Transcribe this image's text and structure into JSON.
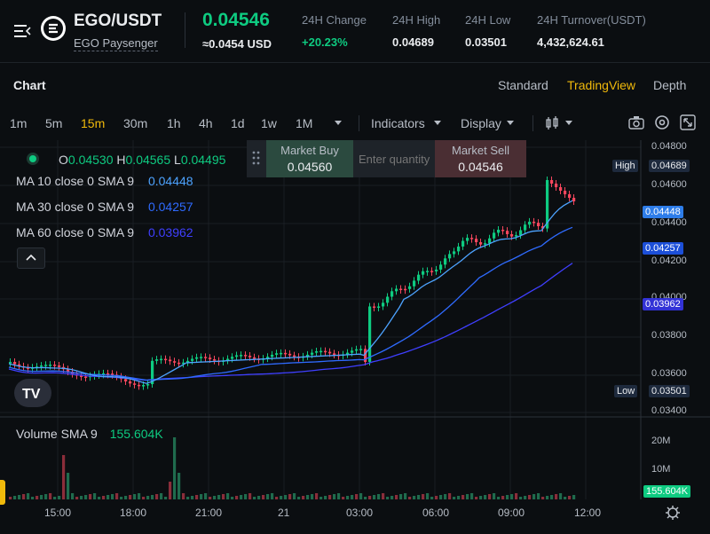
{
  "header": {
    "pair": "EGO/USDT",
    "pair_name": "EGO Paysenger",
    "last_price": "0.04546",
    "last_price_usd": "≈0.0454 USD",
    "stats": [
      {
        "label": "24H Change",
        "value": "+20.23%",
        "color": "#0ecb81"
      },
      {
        "label": "24H High",
        "value": "0.04689",
        "color": "#eaecef"
      },
      {
        "label": "24H Low",
        "value": "0.03501",
        "color": "#eaecef"
      },
      {
        "label": "24H Turnover(USDT)",
        "value": "4,432,624.61",
        "color": "#eaecef"
      }
    ]
  },
  "chart_header": {
    "title": "Chart",
    "views": [
      {
        "label": "Standard",
        "active": false
      },
      {
        "label": "TradingView",
        "active": true
      },
      {
        "label": "Depth",
        "active": false
      }
    ]
  },
  "toolbar": {
    "timeframes": [
      {
        "label": "1m",
        "active": false
      },
      {
        "label": "5m",
        "active": false
      },
      {
        "label": "15m",
        "active": true
      },
      {
        "label": "30m",
        "active": false
      },
      {
        "label": "1h",
        "active": false
      },
      {
        "label": "4h",
        "active": false
      },
      {
        "label": "1d",
        "active": false
      },
      {
        "label": "1w",
        "active": false
      },
      {
        "label": "1M",
        "active": false
      }
    ],
    "indicators_label": "Indicators",
    "display_label": "Display",
    "icons": [
      "candle-type-icon",
      "camera-icon",
      "settings-icon",
      "fullscreen-icon"
    ]
  },
  "legend": {
    "ohlc": {
      "o_label": "O",
      "o": "0.04530",
      "h_label": "H",
      "h": "0.04565",
      "l_label": "L",
      "l": "0.04495"
    },
    "ma": [
      {
        "label": "MA 10 close 0 SMA 9",
        "value": "0.04448",
        "color": "#4da3ff"
      },
      {
        "label": "MA 30 close 0 SMA 9",
        "value": "0.04257",
        "color": "#2f6bff"
      },
      {
        "label": "MA 60 close 0 SMA 9",
        "value": "0.03962",
        "color": "#3f3fff"
      }
    ]
  },
  "market_widget": {
    "buy_label": "Market Buy",
    "buy_price": "0.04560",
    "input_placeholder": "Enter quantity",
    "sell_label": "Market Sell",
    "sell_price": "0.04546"
  },
  "price_axis": {
    "ticks": [
      "0.04800",
      "0.04600",
      "0.04400",
      "0.04200",
      "0.04000",
      "0.03800",
      "0.03600",
      "0.03400"
    ],
    "high_label": "High",
    "high_value": "0.04689",
    "low_label": "Low",
    "low_value": "0.03501",
    "ma10_tag": "0.04448",
    "ma30_tag": "0.04257",
    "ma60_tag": "0.03962"
  },
  "volume": {
    "legend_label": "Volume SMA 9",
    "legend_value": "155.604K",
    "ticks": [
      "20M",
      "10M"
    ],
    "current_tag": "155.604K"
  },
  "time_axis": [
    "15:00",
    "18:00",
    "21:00",
    "21",
    "03:00",
    "06:00",
    "09:00",
    "12:00"
  ],
  "colors": {
    "up": "#0ecb81",
    "down": "#f6465d",
    "accent": "#f0b90b",
    "ma10": "#4da3ff",
    "ma30": "#2f6bff",
    "ma60": "#3f3fff"
  }
}
